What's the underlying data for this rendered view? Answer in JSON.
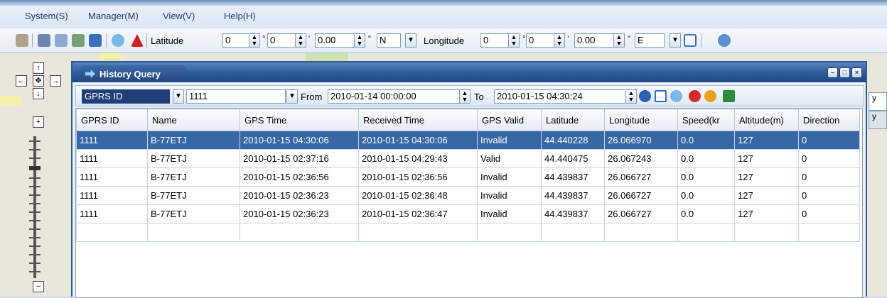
{
  "menu": [
    "System(S)",
    "Manager(M)",
    "View(V)",
    "Help(H)"
  ],
  "toolbar": {
    "latitude_label": "Latitude",
    "lat_deg": "0",
    "lat_min": "0",
    "lat_sec": "0.00",
    "lat_hem": "N",
    "longitude_label": "Longitude",
    "lon_deg": "0",
    "lon_min": "0",
    "lon_sec": "0.00",
    "lon_hem": "E",
    "deg_symbol": "°",
    "min_symbol": "'",
    "sec_symbol": "\""
  },
  "window": {
    "title": "History Query",
    "query": {
      "field_select": "GPRS ID",
      "id_value": "1111",
      "from_label": "From",
      "from_value": "2010-01-14 00:00:00",
      "to_label": "To",
      "to_value": "2010-01-15 04:30:24"
    },
    "table": {
      "columns": [
        "GPRS ID",
        "Name",
        "GPS Time",
        "Received Time",
        "GPS Valid",
        "Latitude",
        "Longitude",
        "Speed(kr",
        "Altitude(m)",
        "Direction"
      ],
      "rows": [
        [
          "1111",
          "B-77ETJ",
          "2010-01-15 04:30:06",
          "2010-01-15 04:30:06",
          "Invalid",
          "44.440228",
          "26.066970",
          "0.0",
          "127",
          "0"
        ],
        [
          "1111",
          "B-77ETJ",
          "2010-01-15 02:37:16",
          "2010-01-15 04:29:43",
          "Valid",
          "44.440475",
          "26.067243",
          "0.0",
          "127",
          "0"
        ],
        [
          "1111",
          "B-77ETJ",
          "2010-01-15 02:36:56",
          "2010-01-15 02:36:56",
          "Invalid",
          "44.439837",
          "26.066727",
          "0.0",
          "127",
          "0"
        ],
        [
          "1111",
          "B-77ETJ",
          "2010-01-15 02:36:23",
          "2010-01-15 02:36:48",
          "Invalid",
          "44.439837",
          "26.066727",
          "0.0",
          "127",
          "0"
        ],
        [
          "1111",
          "B-77ETJ",
          "2010-01-15 02:36:23",
          "2010-01-15 02:36:47",
          "Invalid",
          "44.439837",
          "26.066727",
          "0.0",
          "127",
          "0"
        ]
      ],
      "selected_row": 0
    }
  },
  "right_panel": {
    "box1": "y",
    "box2": "y"
  },
  "colors": {
    "title_bar": "#2c5a98",
    "selection": "#3767a5",
    "menu_text": "#1c3c74"
  },
  "icons": [
    "map-pointer-icon",
    "book-icon",
    "person-icon",
    "route-icon",
    "monitor-icon",
    "globe-icon",
    "alarm-icon",
    "zoom-area-icon",
    "refresh-icon",
    "query-icon",
    "export-excel-icon",
    "stop-icon",
    "clear-icon"
  ]
}
